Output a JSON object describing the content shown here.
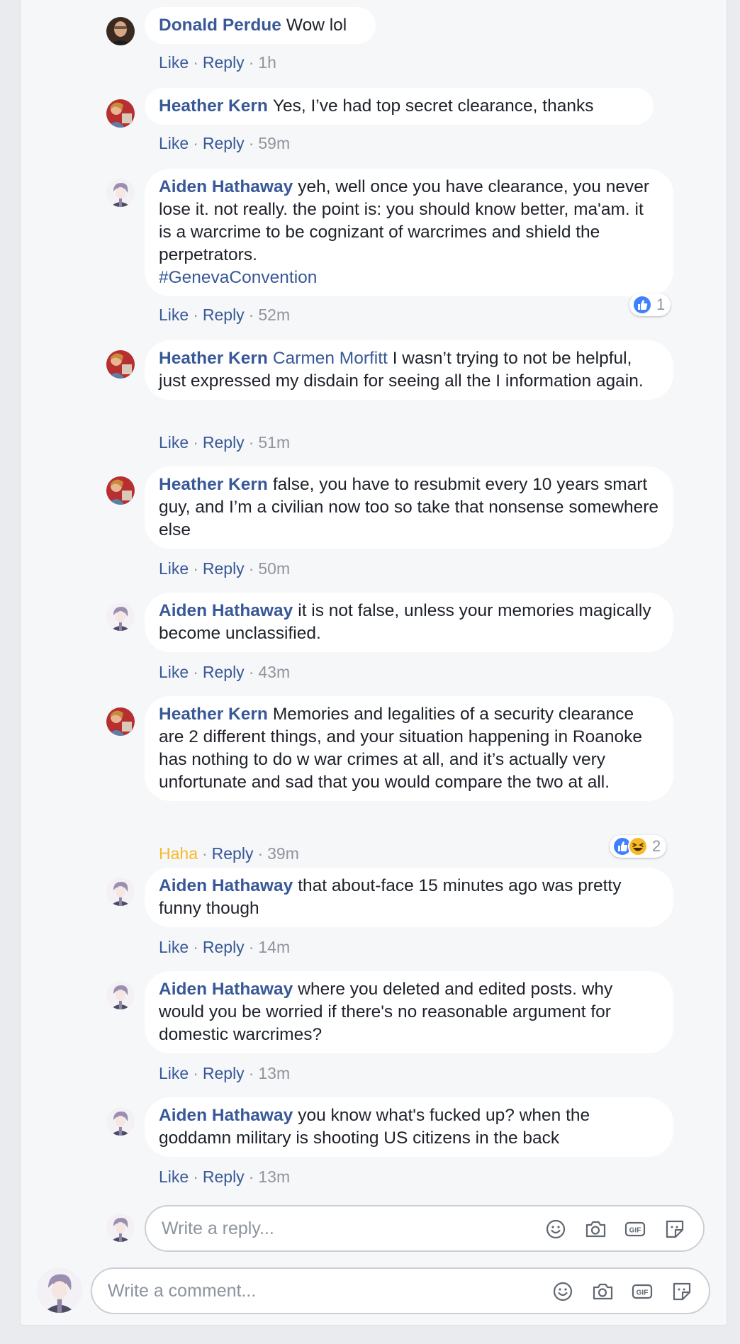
{
  "comments": [
    {
      "author": "Donald Perdue",
      "text": "Wow lol",
      "like": "Like",
      "reply": "Reply",
      "time": "1h"
    },
    {
      "author": "Heather Kern",
      "text": "Yes, I’ve had top secret clearance, thanks",
      "like": "Like",
      "reply": "Reply",
      "time": "59m"
    },
    {
      "author": "Aiden Hathaway",
      "text": "yeh, well once you have clearance, you never lose it. not really. the point is: you should know better, ma'am. it is a warcrime to be cognizant of warcrimes and shield the perpetrators.",
      "hashtag": "#GenevaConvention",
      "like": "Like",
      "reply": "Reply",
      "time": "52m",
      "reaction_count": "1"
    },
    {
      "author": "Heather Kern",
      "mention": "Carmen Morfitt",
      "text": "I wasn’t trying to not be helpful, just expressed my disdain for seeing all the I information again.",
      "like": "Like",
      "reply": "Reply",
      "time": "51m"
    },
    {
      "author": "Heather Kern",
      "text": "false, you have to resubmit every 10 years smart guy, and I’m a civilian now too so take that nonsense somewhere else",
      "like": "Like",
      "reply": "Reply",
      "time": "50m"
    },
    {
      "author": "Aiden Hathaway",
      "text": "it is not false, unless your memories magically become unclassified.",
      "like": "Like",
      "reply": "Reply",
      "time": "43m"
    },
    {
      "author": "Heather Kern",
      "text": "Memories and legalities of a security clearance are 2 different things, and your situation happening in Roanoke has nothing to do w war crimes at all, and it’s actually very unfortunate and sad that you would compare the two at all.",
      "like": "Haha",
      "reply": "Reply",
      "time": "39m",
      "reaction_count": "2"
    },
    {
      "author": "Aiden Hathaway",
      "text": "that about-face 15 minutes ago was pretty funny though",
      "like": "Like",
      "reply": "Reply",
      "time": "14m"
    },
    {
      "author": "Aiden Hathaway",
      "text": "where you deleted and edited posts. why would you be worried if there's no reasonable argument for domestic warcrimes?",
      "like": "Like",
      "reply": "Reply",
      "time": "13m"
    },
    {
      "author": "Aiden Hathaway",
      "text": "you know what's fucked up? when the goddamn military is shooting US citizens in the back",
      "like": "Like",
      "reply": "Reply",
      "time": "13m"
    }
  ],
  "reply_box": {
    "placeholder": "Write a reply..."
  },
  "comment_box": {
    "placeholder": "Write a comment..."
  },
  "colors": {
    "link": "#385898",
    "haha": "#f7b928",
    "like_blue": "#4080ff",
    "bubble": "#ffffff",
    "background": "#f6f7f9"
  }
}
